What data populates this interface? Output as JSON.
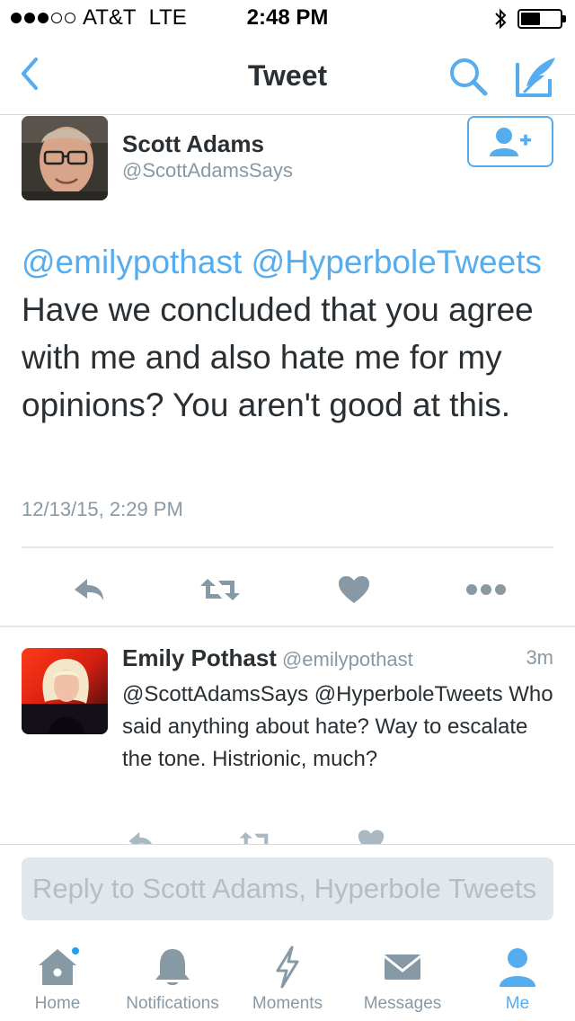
{
  "status_bar": {
    "carrier": "AT&T",
    "network": "LTE",
    "time": "2:48 PM",
    "signal_bars_filled": 3,
    "signal_bars_total": 5,
    "battery_level": 0.5
  },
  "nav": {
    "title": "Tweet",
    "back_icon": "chevron-left-icon",
    "search_icon": "search-icon",
    "compose_icon": "compose-tweet-icon"
  },
  "main_tweet": {
    "author_name": "Scott Adams",
    "author_handle": "@ScottAdamsSays",
    "mention_1": "@emilypothast",
    "mention_2": "@HyperboleTweets",
    "text": "Have we concluded that you agree with me and also hate me for my opinions? You aren't good at this.",
    "timestamp": "12/13/15, 2:29 PM",
    "follow_icon": "add-user-icon"
  },
  "reply": {
    "author_name": "Emily Pothast",
    "author_handle": "@emilypothast",
    "time_ago": "3m",
    "text": "@ScottAdamsSays @HyperboleTweets Who said anything about hate? Way to escalate the tone. Histrionic, much?"
  },
  "composer": {
    "placeholder": "Reply to Scott Adams, Hyperbole Tweets"
  },
  "tabs": [
    {
      "label": "Home",
      "icon": "home-icon",
      "active": false,
      "has_badge": true
    },
    {
      "label": "Notifications",
      "icon": "bell-icon",
      "active": false
    },
    {
      "label": "Moments",
      "icon": "lightning-icon",
      "active": false
    },
    {
      "label": "Messages",
      "icon": "envelope-icon",
      "active": false
    },
    {
      "label": "Me",
      "icon": "person-icon",
      "active": true
    }
  ],
  "colors": {
    "accent": "#55acee",
    "text": "#292f33",
    "muted": "#8899a6",
    "divider": "#e1e8ed"
  }
}
